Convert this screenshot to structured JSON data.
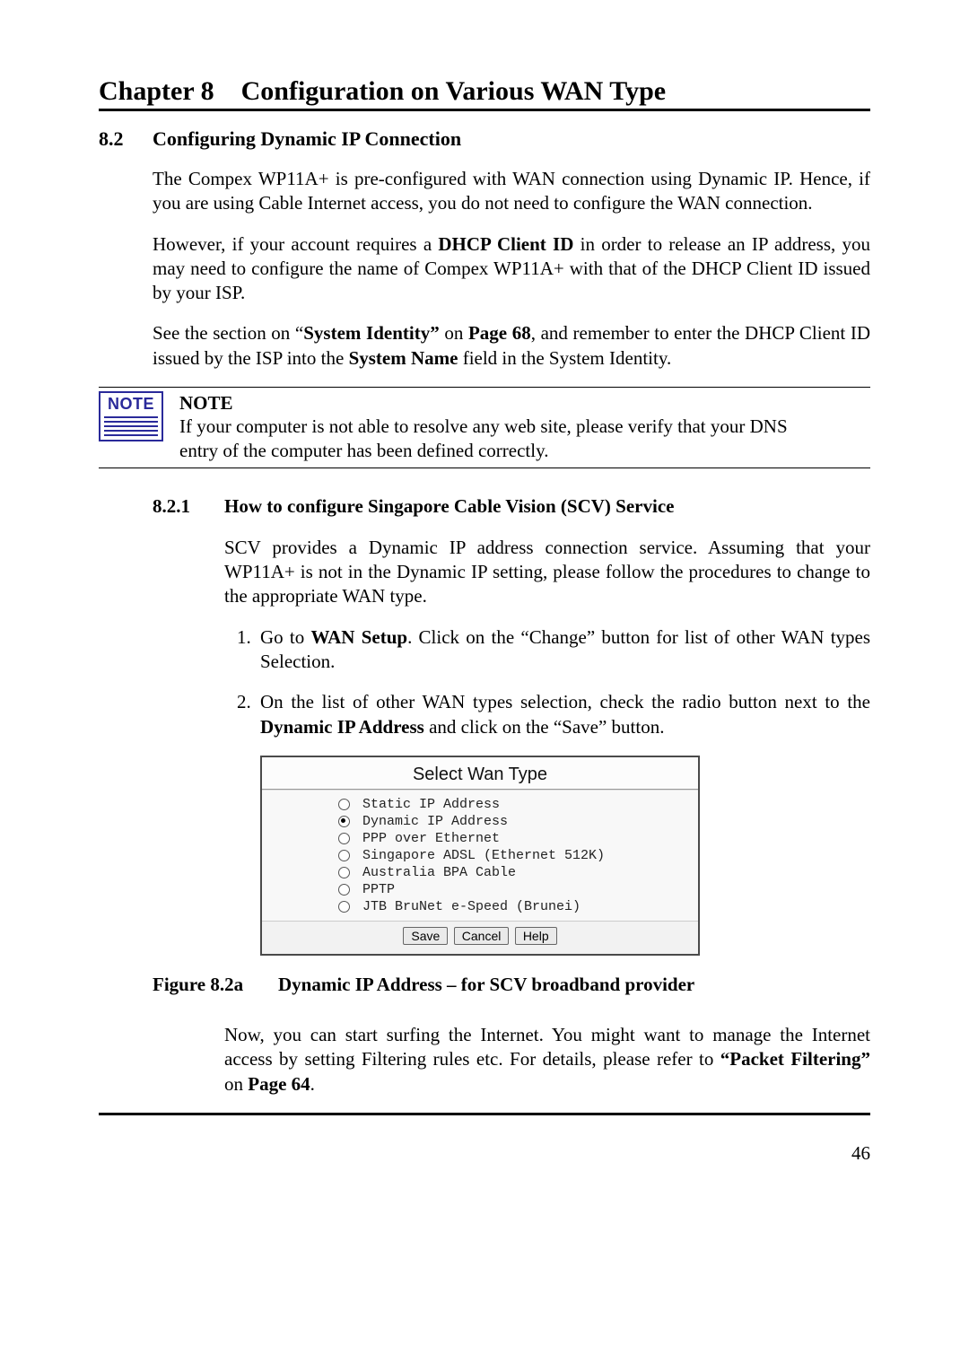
{
  "chapter": {
    "prefix": "Chapter 8",
    "title": "Configuration on Various WAN Type"
  },
  "section": {
    "number": "8.2",
    "title": "Configuring Dynamic IP Connection",
    "p1": "The Compex WP11A+ is pre-configured with WAN connection using Dynamic IP. Hence, if you are using Cable Internet access, you do not need to configure the WAN connection.",
    "p2_a": "However, if your account requires a ",
    "p2_b": "DHCP Client ID",
    "p2_c": " in order to release an IP address, you may need to configure the name of Compex WP11A+ with that of the DHCP Client ID issued by your ISP.",
    "p3_a": "See the section on “",
    "p3_b": "System Identity”",
    "p3_c": " on ",
    "p3_d": "Page 68",
    "p3_e": ", and remember to enter the DHCP Client ID issued by the ISP into the ",
    "p3_f": "System Name",
    "p3_g": " field in the System Identity."
  },
  "note": {
    "icon_label": "NOTE",
    "heading": "NOTE",
    "text": "If your computer is not able to resolve any web site, please verify that your DNS entry of the computer has been defined correctly."
  },
  "subsection": {
    "number": "8.2.1",
    "title": "How to configure Singapore Cable Vision (SCV) Service",
    "p1": "SCV provides a Dynamic IP address connection service. Assuming that your WP11A+ is not in the Dynamic IP setting, please follow the procedures to change to the appropriate WAN type.",
    "steps": {
      "s1_a": "Go to ",
      "s1_b": "WAN Setup",
      "s1_c": ". Click on the “Change” button for list of other WAN types Selection.",
      "s2_a": "On the list of other WAN types selection, check the radio button next to the ",
      "s2_b": "Dynamic IP Address",
      "s2_c": " and click on the “Save” button."
    },
    "post_a": "Now, you can start surfing the Internet. You might want to manage the Internet access by setting Filtering rules etc. For details, please refer to ",
    "post_b": "“Packet Filtering”",
    "post_c": " on ",
    "post_d": "Page 64",
    "post_e": "."
  },
  "figure": {
    "dialog_title": "Select Wan Type",
    "options": [
      "Static IP Address",
      "Dynamic IP Address",
      "PPP over Ethernet",
      "Singapore ADSL (Ethernet 512K)",
      "Australia BPA Cable",
      "PPTP",
      "JTB BruNet e-Speed (Brunei)"
    ],
    "selected_index": 1,
    "buttons": {
      "save": "Save",
      "cancel": "Cancel",
      "help": "Help"
    },
    "caption_num": "Figure 8.2a",
    "caption_txt": "Dynamic IP Address – for SCV broadband provider"
  },
  "page_number": "46"
}
